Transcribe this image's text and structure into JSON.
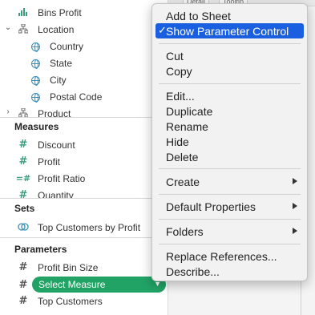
{
  "right_area": {
    "buttons": [
      "Detail",
      "Tooltip"
    ]
  },
  "data_pane": {
    "dimensions": [
      {
        "label": "Bins Profit",
        "icon": "bar-chart-icon"
      },
      {
        "label": "Location",
        "icon": "hierarchy-icon"
      },
      {
        "label": "Country",
        "icon": "globe-icon"
      },
      {
        "label": "State",
        "icon": "globe-icon"
      },
      {
        "label": "City",
        "icon": "globe-icon"
      },
      {
        "label": "Postal Code",
        "icon": "globe-icon"
      },
      {
        "label": "Product",
        "icon": "hierarchy-icon"
      }
    ],
    "measures_title": "Measures",
    "measures": [
      {
        "label": "Discount"
      },
      {
        "label": "Profit"
      },
      {
        "label": "Profit Ratio"
      },
      {
        "label": "Quantity"
      }
    ],
    "sets_title": "Sets",
    "sets": [
      {
        "label": "Top Customers by Profit"
      }
    ],
    "parameters_title": "Parameters",
    "parameters": [
      {
        "label": "Profit Bin Size"
      },
      {
        "label": "Select Measure"
      },
      {
        "label": "Top Customers"
      }
    ]
  },
  "context_menu": {
    "items": [
      {
        "label": "Add to Sheet"
      },
      {
        "label": "Show Parameter Control",
        "checked": true,
        "highlighted": true
      },
      {
        "label": "Cut"
      },
      {
        "label": "Copy"
      },
      {
        "label": "Edit..."
      },
      {
        "label": "Duplicate"
      },
      {
        "label": "Rename"
      },
      {
        "label": "Hide"
      },
      {
        "label": "Delete"
      },
      {
        "label": "Create",
        "submenu": true
      },
      {
        "label": "Default Properties",
        "submenu": true
      },
      {
        "label": "Folders",
        "submenu": true
      },
      {
        "label": "Replace References..."
      },
      {
        "label": "Describe..."
      }
    ],
    "check_glyph": "✓"
  },
  "colors": {
    "accent": "#1a5fe0",
    "pill": "#21a366",
    "measure_icon": "#3a9f7a",
    "geo_icon": "#3a8fb7"
  }
}
